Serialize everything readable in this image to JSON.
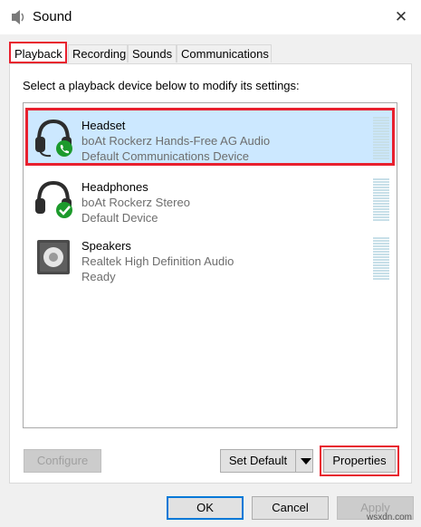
{
  "window": {
    "title": "Sound",
    "close_label": "✕"
  },
  "tabs": [
    {
      "label": "Playback"
    },
    {
      "label": "Recording"
    },
    {
      "label": "Sounds"
    },
    {
      "label": "Communications"
    }
  ],
  "panel": {
    "instruction": "Select a playback device below to modify its settings:"
  },
  "devices": [
    {
      "name": "Headset",
      "description": "boAt Rockerz Hands-Free AG Audio",
      "status": "Default Communications Device",
      "icon": "headset-phone-icon",
      "selected": true
    },
    {
      "name": "Headphones",
      "description": "boAt Rockerz Stereo",
      "status": "Default Device",
      "icon": "headphones-check-icon",
      "selected": false
    },
    {
      "name": "Speakers",
      "description": "Realtek High Definition Audio",
      "status": "Ready",
      "icon": "speaker-icon",
      "selected": false
    }
  ],
  "buttons": {
    "configure": "Configure",
    "set_default": "Set Default",
    "properties": "Properties",
    "ok": "OK",
    "cancel": "Cancel",
    "apply": "Apply"
  },
  "watermark": "wsxdn.com",
  "colors": {
    "highlight_outline": "#e8202e",
    "selection": "#cce8ff",
    "badge_green": "#1c9a2c"
  }
}
